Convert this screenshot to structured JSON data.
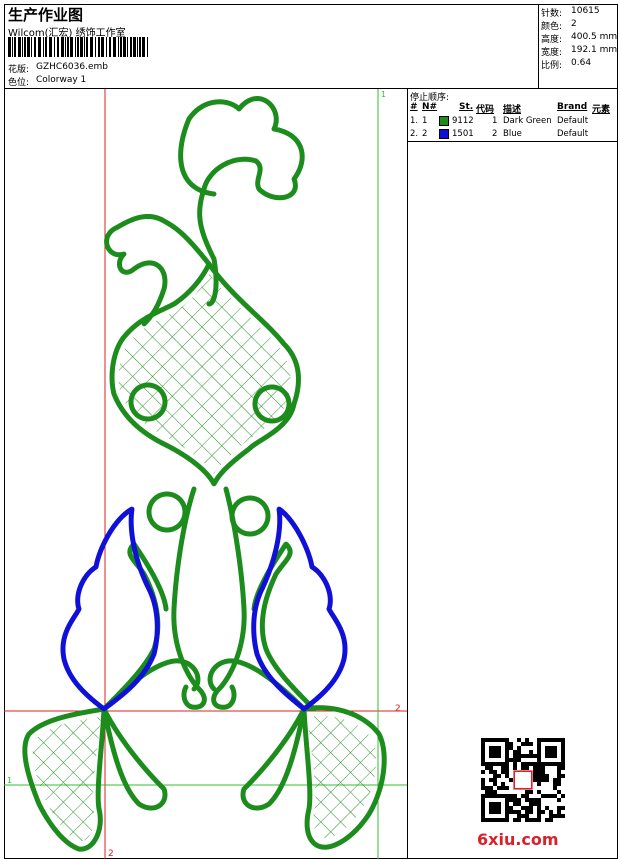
{
  "header": {
    "title": "生产作业图",
    "subtitle": "Wilcom(汇宏) 绣饰工作室",
    "design_label": "花版:",
    "design_value": "GZHC6036.emb",
    "colorway_label": "色位:",
    "colorway_value": "Colorway 1"
  },
  "stats": {
    "stitches_label": "针数:",
    "stitches_value": "10615",
    "colors_label": "颜色:",
    "colors_value": "2",
    "height_label": "高度:",
    "height_value": "400.5 mm",
    "width_label": "宽度:",
    "width_value": "192.1 mm",
    "scale_label": "比例:",
    "scale_value": "0.64"
  },
  "sequence": {
    "title": "停止顺序:",
    "headers": [
      "#",
      "N#",
      "St.",
      "代码",
      "描述",
      "Brand",
      "元素"
    ],
    "rows": [
      {
        "num": "1.",
        "n": "1",
        "color": "#1c8c1c",
        "st": "9112",
        "code": "1",
        "desc": "Dark Green",
        "brand": "Default"
      },
      {
        "num": "2.",
        "n": "2",
        "color": "#1010d8",
        "st": "1501",
        "code": "2",
        "desc": "Blue",
        "brand": "Default"
      }
    ]
  },
  "guides": {
    "marker_1_top": "1",
    "marker_2_right": "2",
    "marker_1_left": "1",
    "marker_2_bottom": "2"
  },
  "colors": {
    "green": "#1c8c1c",
    "blue": "#1010d8",
    "guide_red": "#d82020",
    "guide_green": "#30c030"
  },
  "watermark": {
    "text": "6xiu.com"
  }
}
